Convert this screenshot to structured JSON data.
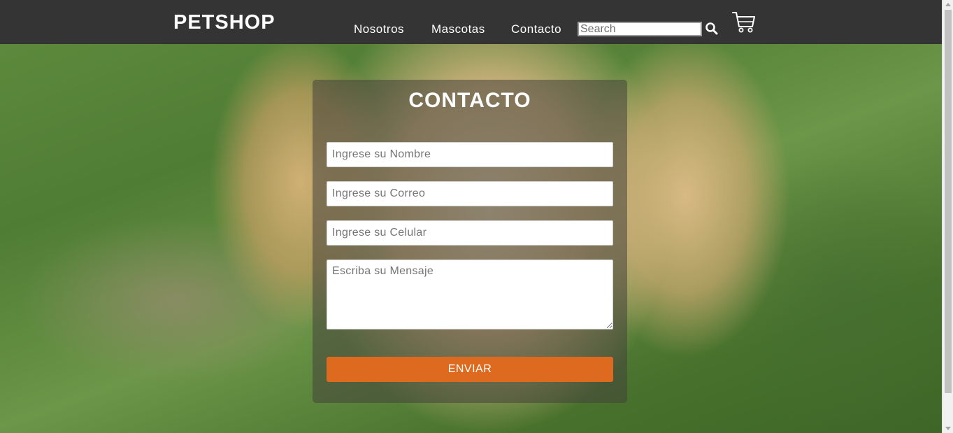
{
  "navbar": {
    "brand": "PETSHOP",
    "links": [
      "Nosotros",
      "Mascotas",
      "Contacto"
    ],
    "search_placeholder": "Search",
    "search_icon": "search-icon",
    "cart_icon": "shopping-cart-icon"
  },
  "contact": {
    "title": "CONTACTO",
    "name_placeholder": "Ingrese su Nombre",
    "email_placeholder": "Ingrese su Correo",
    "phone_placeholder": "Ingrese su Celular",
    "message_placeholder": "Escriba su Mensaje",
    "submit_label": "ENVIAR"
  },
  "colors": {
    "navbar": "#343434",
    "accent": "#de6a1f",
    "card_overlay": "rgba(70,65,60,0.55)"
  }
}
